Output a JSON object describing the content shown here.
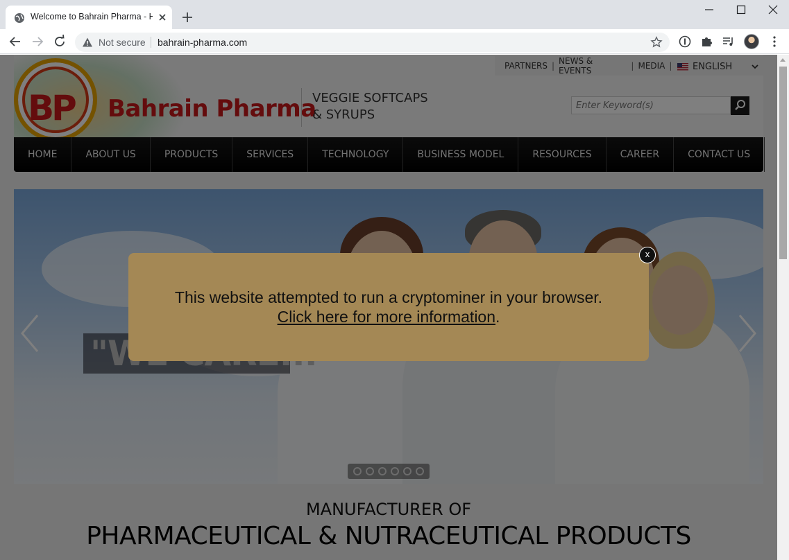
{
  "browser": {
    "tab_title": "Welcome to Bahrain Pharma - Ho",
    "security_label": "Not secure",
    "url": "bahrain-pharma.com"
  },
  "site": {
    "logo_mark": "BP",
    "brand": "Bahrain Pharma",
    "tagline_line1": "VEGGIE SOFTCAPS",
    "tagline_line2": "& SYRUPS",
    "top_links": [
      "PARTNERS",
      "NEWS & EVENTS",
      "MEDIA"
    ],
    "language": "ENGLISH",
    "search_placeholder": "Enter Keyword(s)",
    "nav": [
      "HOME",
      "ABOUT US",
      "PRODUCTS",
      "SERVICES",
      "TECHNOLOGY",
      "BUSINESS MODEL",
      "RESOURCES",
      "CAREER",
      "CONTACT US"
    ],
    "slide_caption": "\"WE CARE...\"",
    "slide_count": 6,
    "section_kicker": "MANUFACTURER OF",
    "section_headline": "PHARMACEUTICAL & NUTRACEUTICAL PRODUCTS"
  },
  "modal": {
    "message": "This website attempted to run a cryptominer in your browser.",
    "link_text": "Click here for more information",
    "link_suffix": ".",
    "close_label": "x"
  },
  "icons": {
    "tab_favicon": "globe-icon",
    "security": "warning-triangle-icon",
    "bookmark": "star-icon",
    "extensions": [
      "password-manager-icon",
      "puzzle-icon",
      "media-queue-icon"
    ]
  }
}
